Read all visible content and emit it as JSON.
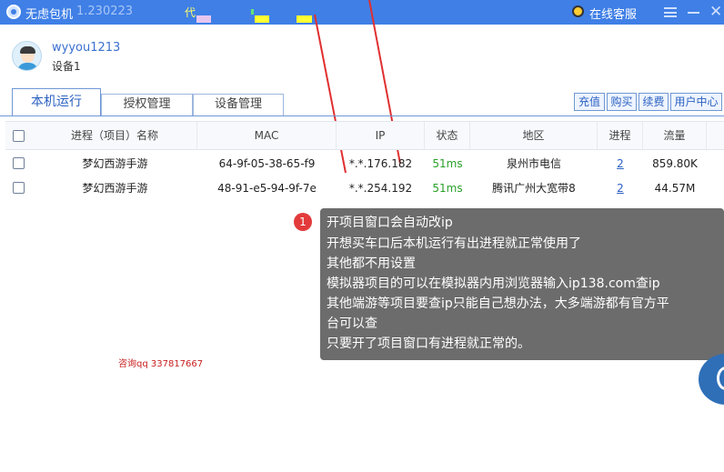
{
  "titlebar": {
    "app_title": "无虑包机",
    "version": "1.230223",
    "marquee_text": "代",
    "support_label": "在线客服",
    "icons": [
      "app-logo-icon",
      "headset-icon",
      "menu-icon",
      "minimize-icon",
      "close-icon"
    ],
    "colors": {
      "bar": "#3f7fe6"
    }
  },
  "user": {
    "username": "wyyou1213",
    "device": "设备1"
  },
  "tabs": [
    {
      "label": "本机运行",
      "active": true
    },
    {
      "label": "授权管理",
      "active": false
    },
    {
      "label": "设备管理",
      "active": false
    }
  ],
  "actions": {
    "recharge": "充值",
    "buy": "购买",
    "renew": "续费",
    "user_center": "用户中心"
  },
  "table": {
    "headers": [
      "进程（项目）名称",
      "MAC",
      "IP",
      "状态",
      "地区",
      "进程",
      "流量"
    ],
    "rows": [
      {
        "name": "梦幻西游手游",
        "mac": "64-9f-05-38-65-f9",
        "ip": "*.*.176.182",
        "status": "51ms",
        "region": "泉州市电信",
        "process": "2",
        "traffic": "859.80K"
      },
      {
        "name": "梦幻西游手游",
        "mac": "48-91-e5-94-9f-7e",
        "ip": "*.*.254.192",
        "status": "51ms",
        "region": "腾讯广州大宽带8",
        "process": "2",
        "traffic": "44.57M"
      }
    ]
  },
  "tip": {
    "badge": "1",
    "lines": [
      "开项目窗口会自动改ip",
      "开想买车口后本机运行有出进程就正常使用了",
      "其他都不用设置",
      "模拟器项目的可以在模拟器内用浏览器输入ip138.com查ip",
      "其他端游等项目要查ip只能自己想办法，大多端游都有官方平",
      "台可以查",
      "只要开了项目窗口有进程就正常的。"
    ]
  },
  "contact": "咨询qq 337817667"
}
